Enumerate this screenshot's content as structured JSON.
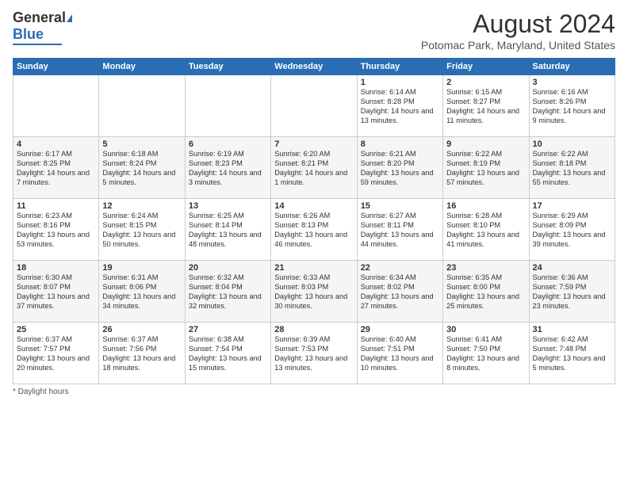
{
  "header": {
    "logo_general": "General",
    "logo_blue": "Blue",
    "main_title": "August 2024",
    "subtitle": "Potomac Park, Maryland, United States"
  },
  "weekdays": [
    "Sunday",
    "Monday",
    "Tuesday",
    "Wednesday",
    "Thursday",
    "Friday",
    "Saturday"
  ],
  "footer": {
    "note": "Daylight hours"
  },
  "weeks": [
    [
      {
        "day": "",
        "info": ""
      },
      {
        "day": "",
        "info": ""
      },
      {
        "day": "",
        "info": ""
      },
      {
        "day": "",
        "info": ""
      },
      {
        "day": "1",
        "info": "Sunrise: 6:14 AM\nSunset: 8:28 PM\nDaylight: 14 hours and 13 minutes."
      },
      {
        "day": "2",
        "info": "Sunrise: 6:15 AM\nSunset: 8:27 PM\nDaylight: 14 hours and 11 minutes."
      },
      {
        "day": "3",
        "info": "Sunrise: 6:16 AM\nSunset: 8:26 PM\nDaylight: 14 hours and 9 minutes."
      }
    ],
    [
      {
        "day": "4",
        "info": "Sunrise: 6:17 AM\nSunset: 8:25 PM\nDaylight: 14 hours and 7 minutes."
      },
      {
        "day": "5",
        "info": "Sunrise: 6:18 AM\nSunset: 8:24 PM\nDaylight: 14 hours and 5 minutes."
      },
      {
        "day": "6",
        "info": "Sunrise: 6:19 AM\nSunset: 8:23 PM\nDaylight: 14 hours and 3 minutes."
      },
      {
        "day": "7",
        "info": "Sunrise: 6:20 AM\nSunset: 8:21 PM\nDaylight: 14 hours and 1 minute."
      },
      {
        "day": "8",
        "info": "Sunrise: 6:21 AM\nSunset: 8:20 PM\nDaylight: 13 hours and 59 minutes."
      },
      {
        "day": "9",
        "info": "Sunrise: 6:22 AM\nSunset: 8:19 PM\nDaylight: 13 hours and 57 minutes."
      },
      {
        "day": "10",
        "info": "Sunrise: 6:22 AM\nSunset: 8:18 PM\nDaylight: 13 hours and 55 minutes."
      }
    ],
    [
      {
        "day": "11",
        "info": "Sunrise: 6:23 AM\nSunset: 8:16 PM\nDaylight: 13 hours and 53 minutes."
      },
      {
        "day": "12",
        "info": "Sunrise: 6:24 AM\nSunset: 8:15 PM\nDaylight: 13 hours and 50 minutes."
      },
      {
        "day": "13",
        "info": "Sunrise: 6:25 AM\nSunset: 8:14 PM\nDaylight: 13 hours and 48 minutes."
      },
      {
        "day": "14",
        "info": "Sunrise: 6:26 AM\nSunset: 8:13 PM\nDaylight: 13 hours and 46 minutes."
      },
      {
        "day": "15",
        "info": "Sunrise: 6:27 AM\nSunset: 8:11 PM\nDaylight: 13 hours and 44 minutes."
      },
      {
        "day": "16",
        "info": "Sunrise: 6:28 AM\nSunset: 8:10 PM\nDaylight: 13 hours and 41 minutes."
      },
      {
        "day": "17",
        "info": "Sunrise: 6:29 AM\nSunset: 8:09 PM\nDaylight: 13 hours and 39 minutes."
      }
    ],
    [
      {
        "day": "18",
        "info": "Sunrise: 6:30 AM\nSunset: 8:07 PM\nDaylight: 13 hours and 37 minutes."
      },
      {
        "day": "19",
        "info": "Sunrise: 6:31 AM\nSunset: 8:06 PM\nDaylight: 13 hours and 34 minutes."
      },
      {
        "day": "20",
        "info": "Sunrise: 6:32 AM\nSunset: 8:04 PM\nDaylight: 13 hours and 32 minutes."
      },
      {
        "day": "21",
        "info": "Sunrise: 6:33 AM\nSunset: 8:03 PM\nDaylight: 13 hours and 30 minutes."
      },
      {
        "day": "22",
        "info": "Sunrise: 6:34 AM\nSunset: 8:02 PM\nDaylight: 13 hours and 27 minutes."
      },
      {
        "day": "23",
        "info": "Sunrise: 6:35 AM\nSunset: 8:00 PM\nDaylight: 13 hours and 25 minutes."
      },
      {
        "day": "24",
        "info": "Sunrise: 6:36 AM\nSunset: 7:59 PM\nDaylight: 13 hours and 23 minutes."
      }
    ],
    [
      {
        "day": "25",
        "info": "Sunrise: 6:37 AM\nSunset: 7:57 PM\nDaylight: 13 hours and 20 minutes."
      },
      {
        "day": "26",
        "info": "Sunrise: 6:37 AM\nSunset: 7:56 PM\nDaylight: 13 hours and 18 minutes."
      },
      {
        "day": "27",
        "info": "Sunrise: 6:38 AM\nSunset: 7:54 PM\nDaylight: 13 hours and 15 minutes."
      },
      {
        "day": "28",
        "info": "Sunrise: 6:39 AM\nSunset: 7:53 PM\nDaylight: 13 hours and 13 minutes."
      },
      {
        "day": "29",
        "info": "Sunrise: 6:40 AM\nSunset: 7:51 PM\nDaylight: 13 hours and 10 minutes."
      },
      {
        "day": "30",
        "info": "Sunrise: 6:41 AM\nSunset: 7:50 PM\nDaylight: 13 hours and 8 minutes."
      },
      {
        "day": "31",
        "info": "Sunrise: 6:42 AM\nSunset: 7:48 PM\nDaylight: 13 hours and 5 minutes."
      }
    ]
  ]
}
